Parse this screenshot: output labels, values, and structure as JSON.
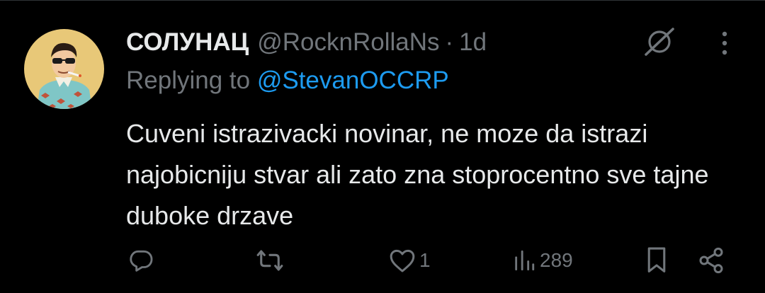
{
  "tweet": {
    "display_name": "СОЛУНАЦ",
    "handle": "@RocknRollaNs",
    "separator": "·",
    "time": "1d",
    "replying_prefix": "Replying to ",
    "replying_to": "@StevanOCCRP",
    "text": "Cuveni istrazivacki novinar, ne moze da istrazi najobicniju stvar ali zato zna stoprocentno sve tajne duboke drzave"
  },
  "actions": {
    "reply_icon": "reply-icon",
    "retweet_icon": "retweet-icon",
    "like_icon": "heart-icon",
    "like_count": "1",
    "views_icon": "views-icon",
    "views_count": "289",
    "bookmark_icon": "bookmark-icon",
    "share_icon": "share-icon"
  },
  "icons": {
    "grok": "grok-icon",
    "more": "more-icon"
  },
  "colors": {
    "background": "#000000",
    "text": "#e7e9ea",
    "muted": "#71767b",
    "accent": "#1d9bf0"
  }
}
